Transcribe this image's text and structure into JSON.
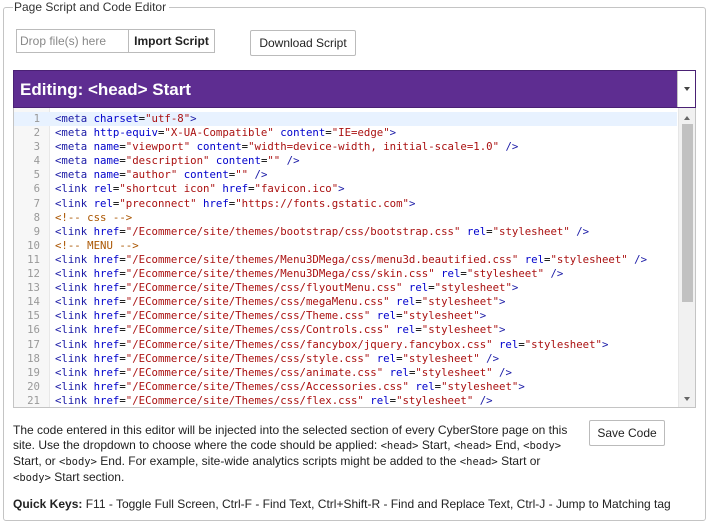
{
  "legend": "Page Script and Code Editor",
  "drop_zone": {
    "placeholder": "Drop file(s) here"
  },
  "buttons": {
    "import": "Import Script",
    "download": "Download Script",
    "save": "Save Code"
  },
  "editor": {
    "title": "Editing: <head> Start",
    "active_line": 1,
    "lines": [
      [
        [
          "tag",
          "<meta "
        ],
        [
          "at",
          "charset"
        ],
        [
          "",
          "="
        ],
        [
          "st",
          "\"utf-8\""
        ],
        [
          "tag",
          ">"
        ]
      ],
      [
        [
          "tag",
          "<meta "
        ],
        [
          "at",
          "http-equiv"
        ],
        [
          "",
          "="
        ],
        [
          "st",
          "\"X-UA-Compatible\""
        ],
        [
          "at",
          " content"
        ],
        [
          "",
          "="
        ],
        [
          "st",
          "\"IE=edge\""
        ],
        [
          "tag",
          ">"
        ]
      ],
      [
        [
          "tag",
          "<meta "
        ],
        [
          "at",
          "name"
        ],
        [
          "",
          "="
        ],
        [
          "st",
          "\"viewport\""
        ],
        [
          "at",
          " content"
        ],
        [
          "",
          "="
        ],
        [
          "st",
          "\"width=device-width, initial-scale=1.0\""
        ],
        [
          "tag",
          " />"
        ]
      ],
      [
        [
          "tag",
          "<meta "
        ],
        [
          "at",
          "name"
        ],
        [
          "",
          "="
        ],
        [
          "st",
          "\"description\""
        ],
        [
          "at",
          " content"
        ],
        [
          "",
          "="
        ],
        [
          "st",
          "\"\""
        ],
        [
          "tag",
          " />"
        ]
      ],
      [
        [
          "tag",
          "<meta "
        ],
        [
          "at",
          "name"
        ],
        [
          "",
          "="
        ],
        [
          "st",
          "\"author\""
        ],
        [
          "at",
          " content"
        ],
        [
          "",
          "="
        ],
        [
          "st",
          "\"\""
        ],
        [
          "tag",
          " />"
        ]
      ],
      [
        [
          "tag",
          "<link "
        ],
        [
          "at",
          "rel"
        ],
        [
          "",
          "="
        ],
        [
          "st",
          "\"shortcut icon\""
        ],
        [
          "at",
          " href"
        ],
        [
          "",
          "="
        ],
        [
          "st",
          "\"favicon.ico\""
        ],
        [
          "tag",
          ">"
        ]
      ],
      [
        [
          "tag",
          "<link "
        ],
        [
          "at",
          "rel"
        ],
        [
          "",
          "="
        ],
        [
          "st",
          "\"preconnect\""
        ],
        [
          "at",
          " href"
        ],
        [
          "",
          "="
        ],
        [
          "st",
          "\"https://fonts.gstatic.com\""
        ],
        [
          "tag",
          ">"
        ]
      ],
      [
        [
          "cm",
          "<!-- css -->"
        ]
      ],
      [
        [
          "tag",
          "<link "
        ],
        [
          "at",
          "href"
        ],
        [
          "",
          "="
        ],
        [
          "st",
          "\"/Ecommerce/site/themes/bootstrap/css/bootstrap.css\""
        ],
        [
          "at",
          " rel"
        ],
        [
          "",
          "="
        ],
        [
          "st",
          "\"stylesheet\""
        ],
        [
          "tag",
          " />"
        ]
      ],
      [
        [
          "cm",
          "<!-- MENU -->"
        ]
      ],
      [
        [
          "tag",
          "<link "
        ],
        [
          "at",
          "href"
        ],
        [
          "",
          "="
        ],
        [
          "st",
          "\"/Ecommerce/site/themes/Menu3DMega/css/menu3d.beautified.css\""
        ],
        [
          "at",
          " rel"
        ],
        [
          "",
          "="
        ],
        [
          "st",
          "\"stylesheet\""
        ],
        [
          "tag",
          " />"
        ]
      ],
      [
        [
          "tag",
          "<link "
        ],
        [
          "at",
          "href"
        ],
        [
          "",
          "="
        ],
        [
          "st",
          "\"/Ecommerce/site/themes/Menu3DMega/css/skin.css\""
        ],
        [
          "at",
          " rel"
        ],
        [
          "",
          "="
        ],
        [
          "st",
          "\"stylesheet\""
        ],
        [
          "tag",
          " />"
        ]
      ],
      [
        [
          "tag",
          "<link "
        ],
        [
          "at",
          "href"
        ],
        [
          "",
          "="
        ],
        [
          "st",
          "\"/ECommerce/site/Themes/css/flyoutMenu.css\""
        ],
        [
          "at",
          " rel"
        ],
        [
          "",
          "="
        ],
        [
          "st",
          "\"stylesheet\""
        ],
        [
          "tag",
          ">"
        ]
      ],
      [
        [
          "tag",
          "<link "
        ],
        [
          "at",
          "href"
        ],
        [
          "",
          "="
        ],
        [
          "st",
          "\"/ECommerce/site/Themes/css/megaMenu.css\""
        ],
        [
          "at",
          " rel"
        ],
        [
          "",
          "="
        ],
        [
          "st",
          "\"stylesheet\""
        ],
        [
          "tag",
          ">"
        ]
      ],
      [
        [
          "tag",
          "<link "
        ],
        [
          "at",
          "href"
        ],
        [
          "",
          "="
        ],
        [
          "st",
          "\"/ECommerce/site/Themes/css/Theme.css\""
        ],
        [
          "at",
          " rel"
        ],
        [
          "",
          "="
        ],
        [
          "st",
          "\"stylesheet\""
        ],
        [
          "tag",
          ">"
        ]
      ],
      [
        [
          "tag",
          "<link "
        ],
        [
          "at",
          "href"
        ],
        [
          "",
          "="
        ],
        [
          "st",
          "\"/ECommerce/site/Themes/css/Controls.css\""
        ],
        [
          "at",
          " rel"
        ],
        [
          "",
          "="
        ],
        [
          "st",
          "\"stylesheet\""
        ],
        [
          "tag",
          ">"
        ]
      ],
      [
        [
          "tag",
          "<link "
        ],
        [
          "at",
          "href"
        ],
        [
          "",
          "="
        ],
        [
          "st",
          "\"/ECommerce/site/Themes/css/fancybox/jquery.fancybox.css\""
        ],
        [
          "at",
          " rel"
        ],
        [
          "",
          "="
        ],
        [
          "st",
          "\"stylesheet\""
        ],
        [
          "tag",
          ">"
        ]
      ],
      [
        [
          "tag",
          "<link "
        ],
        [
          "at",
          "href"
        ],
        [
          "",
          "="
        ],
        [
          "st",
          "\"/ECommerce/site/Themes/css/style.css\""
        ],
        [
          "at",
          " rel"
        ],
        [
          "",
          "="
        ],
        [
          "st",
          "\"stylesheet\""
        ],
        [
          "tag",
          " />"
        ]
      ],
      [
        [
          "tag",
          "<link "
        ],
        [
          "at",
          "href"
        ],
        [
          "",
          "="
        ],
        [
          "st",
          "\"/ECommerce/site/Themes/css/animate.css\""
        ],
        [
          "at",
          " rel"
        ],
        [
          "",
          "="
        ],
        [
          "st",
          "\"stylesheet\""
        ],
        [
          "tag",
          " />"
        ]
      ],
      [
        [
          "tag",
          "<link "
        ],
        [
          "at",
          "href"
        ],
        [
          "",
          "="
        ],
        [
          "st",
          "\"/ECommerce/site/Themes/css/Accessories.css\""
        ],
        [
          "at",
          " rel"
        ],
        [
          "",
          "="
        ],
        [
          "st",
          "\"stylesheet\""
        ],
        [
          "tag",
          ">"
        ]
      ],
      [
        [
          "tag",
          "<link "
        ],
        [
          "at",
          "href"
        ],
        [
          "",
          "="
        ],
        [
          "st",
          "\"/ECommerce/site/Themes/css/flex.css\""
        ],
        [
          "at",
          " rel"
        ],
        [
          "",
          "="
        ],
        [
          "st",
          "\"stylesheet\""
        ],
        [
          "tag",
          " />"
        ]
      ]
    ]
  },
  "help": {
    "p1": "The code entered in this editor will be injected into the selected section of every CyberStore page on this site. Use the dropdown to choose where the code should be applied: ",
    "c1": "<head>",
    "p2": " Start, ",
    "c2": "<head>",
    "p3": " End, ",
    "c3": "<body>",
    "p4": " Start, or ",
    "c4": "<body>",
    "p5": " End. For example, site-wide analytics scripts might be added to the ",
    "c5": "<head>",
    "p6": " Start or ",
    "c6": "<body>",
    "p7": " Start section."
  },
  "quick_keys": {
    "label": "Quick Keys:",
    "text": " F11 - Toggle Full Screen, Ctrl-F - Find Text, Ctrl+Shift-R - Find and Replace Text, Ctrl-J - Jump to Matching tag"
  },
  "icons": {
    "dropdown": "chevron-down-icon",
    "scroll_up": "arrow-up-icon",
    "scroll_down": "arrow-down-icon"
  }
}
